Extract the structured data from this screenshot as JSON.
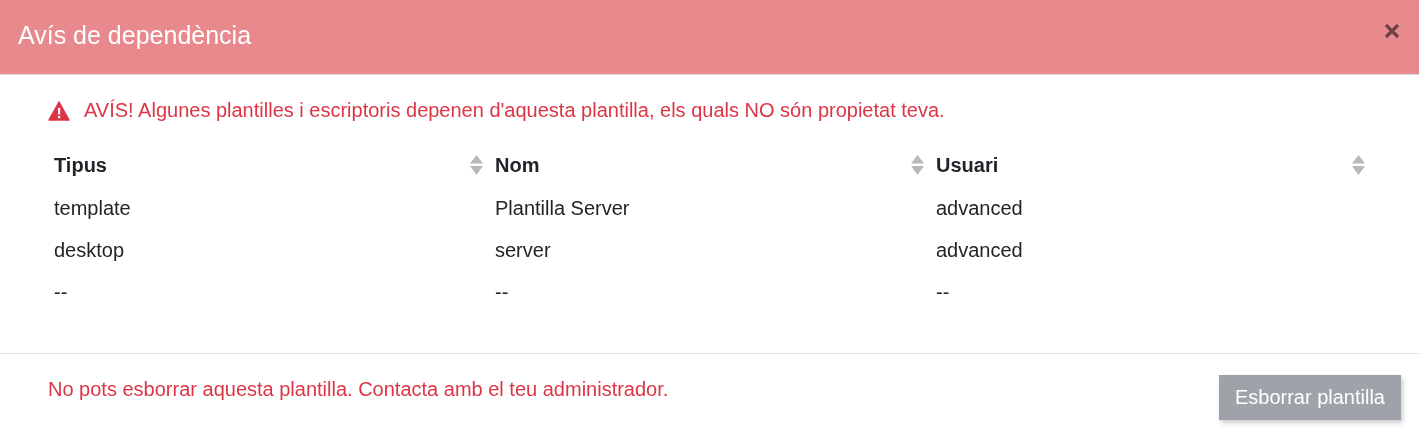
{
  "window": {
    "title": "Avís de dependència"
  },
  "warning": {
    "text": "AVÍS! Algunes plantilles i escriptoris depenen d'aquesta plantilla, els quals NO són propietat teva."
  },
  "table": {
    "columns": [
      {
        "label": "Tipus"
      },
      {
        "label": "Nom"
      },
      {
        "label": "Usuari"
      }
    ],
    "rows": [
      [
        "template",
        "Plantilla Server",
        "advanced"
      ],
      [
        "desktop",
        "server",
        "advanced"
      ],
      [
        "--",
        "--",
        "--"
      ]
    ]
  },
  "footer": {
    "message": "No pots esborrar aquesta plantilla. Contacta amb el teu administrador.",
    "button": {
      "label": "Esborrar plantilla",
      "disabled": true
    }
  }
}
